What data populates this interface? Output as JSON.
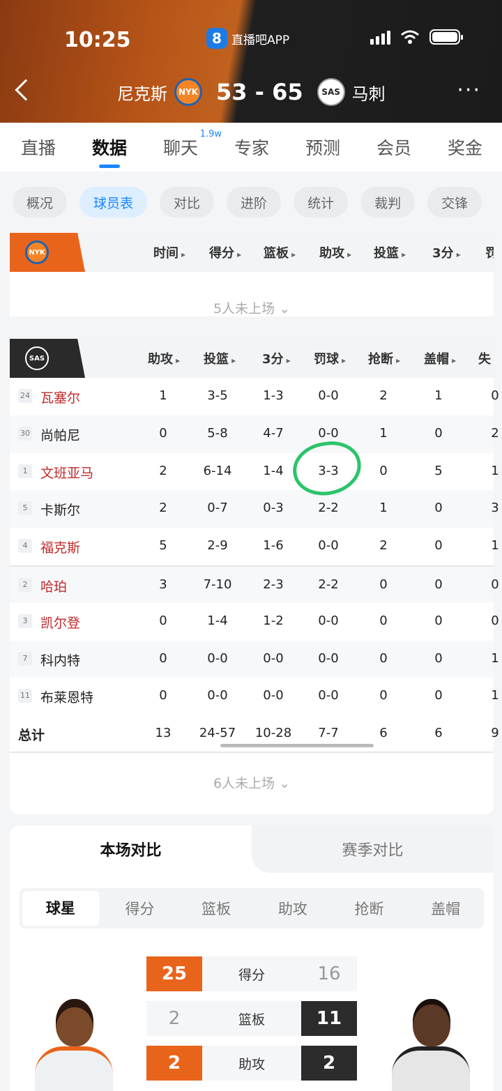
{
  "status_bar": {
    "time": "10:25",
    "app_icon": "8",
    "app_name": "直播吧APP"
  },
  "header": {
    "home_team": "尼克斯",
    "home_logo": "NYK",
    "score": "53 - 65",
    "away_logo": "SAS",
    "away_team": "马刺",
    "more": "···"
  },
  "tabs": [
    {
      "label": "直播"
    },
    {
      "label": "数据",
      "active": true
    },
    {
      "label": "聊天",
      "badge": "1.9w"
    },
    {
      "label": "专家"
    },
    {
      "label": "预测"
    },
    {
      "label": "会员"
    },
    {
      "label": "奖金"
    }
  ],
  "chips": [
    "概况",
    "球员表",
    "对比",
    "进阶",
    "统计",
    "裁判",
    "交锋"
  ],
  "nyk_table": {
    "logo": "NYK",
    "columns": [
      "时间",
      "得分",
      "篮板",
      "助攻",
      "投篮",
      "3分",
      "罚"
    ],
    "dnp": "5人未上场 ⌄"
  },
  "sas_table": {
    "logo": "SAS",
    "columns": [
      "助攻",
      "投篮",
      "3分",
      "罚球",
      "抢断",
      "盖帽",
      "失"
    ],
    "rows": [
      {
        "num": "24",
        "name": "瓦塞尔",
        "starter": true,
        "ast": "1",
        "fg": "3-5",
        "tp": "1-3",
        "ft": "0-0",
        "stl": "2",
        "blk": "1",
        "to": "0"
      },
      {
        "num": "30",
        "name": "尚帕尼",
        "starter": false,
        "ast": "0",
        "fg": "5-8",
        "tp": "4-7",
        "ft": "0-0",
        "stl": "1",
        "blk": "0",
        "to": "2"
      },
      {
        "num": "1",
        "name": "文班亚马",
        "starter": true,
        "ast": "2",
        "fg": "6-14",
        "tp": "1-4",
        "ft": "3-3",
        "stl": "0",
        "blk": "5",
        "to": "1"
      },
      {
        "num": "5",
        "name": "卡斯尔",
        "starter": false,
        "ast": "2",
        "fg": "0-7",
        "tp": "0-3",
        "ft": "2-2",
        "stl": "1",
        "blk": "0",
        "to": "3"
      },
      {
        "num": "4",
        "name": "福克斯",
        "starter": true,
        "ast": "5",
        "fg": "2-9",
        "tp": "1-6",
        "ft": "0-0",
        "stl": "2",
        "blk": "0",
        "to": "1"
      },
      {
        "num": "2",
        "name": "哈珀",
        "starter": true,
        "ast": "3",
        "fg": "7-10",
        "tp": "2-3",
        "ft": "2-2",
        "stl": "0",
        "blk": "0",
        "to": "0"
      },
      {
        "num": "3",
        "name": "凯尔登",
        "starter": true,
        "ast": "0",
        "fg": "1-4",
        "tp": "1-2",
        "ft": "0-0",
        "stl": "0",
        "blk": "0",
        "to": "0"
      },
      {
        "num": "7",
        "name": "科内特",
        "starter": false,
        "ast": "0",
        "fg": "0-0",
        "tp": "0-0",
        "ft": "0-0",
        "stl": "0",
        "blk": "0",
        "to": "1"
      },
      {
        "num": "11",
        "name": "布莱恩特",
        "starter": false,
        "ast": "0",
        "fg": "0-0",
        "tp": "0-0",
        "ft": "0-0",
        "stl": "0",
        "blk": "0",
        "to": "1"
      }
    ],
    "total": {
      "name": "总计",
      "ast": "13",
      "fg": "24-57",
      "tp": "10-28",
      "ft": "7-7",
      "stl": "6",
      "blk": "6",
      "to": "9"
    },
    "dnp": "6人未上场 ⌄"
  },
  "compare": {
    "tab_game": "本场对比",
    "tab_season": "赛季对比",
    "segments": [
      "球星",
      "得分",
      "篮板",
      "助攻",
      "抢断",
      "盖帽"
    ],
    "stats": [
      {
        "label": "得分",
        "left": "25",
        "right": "16"
      },
      {
        "label": "篮板",
        "left": "2",
        "right": "11"
      },
      {
        "label": "助攻",
        "left": "2",
        "right": "2"
      }
    ]
  },
  "colors": {
    "nyk": "#e9641b",
    "sas": "#2a2a2a",
    "accent": "#1a86ff",
    "starter": "#c12a2a",
    "annotation": "#2bc46a"
  }
}
